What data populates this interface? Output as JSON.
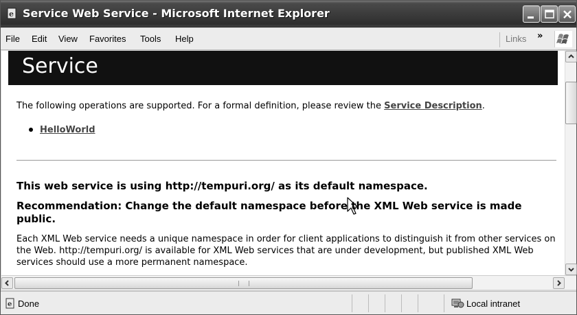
{
  "window": {
    "title": "Service Web Service - Microsoft Internet Explorer"
  },
  "menu": {
    "items": [
      "File",
      "Edit",
      "View",
      "Favorites",
      "Tools",
      "Help"
    ],
    "links_label": "Links",
    "links_chevron": "»"
  },
  "page": {
    "title": "Service",
    "intro_prefix": "The following operations are supported. For a formal definition, please review the ",
    "intro_link": "Service Description",
    "intro_suffix": ".",
    "operations": [
      "HelloWorld"
    ],
    "namespace_heading": "This web service is using http://tempuri.org/ as its default namespace.",
    "recommendation_heading": "Recommendation: Change the default namespace before the XML Web service is made public.",
    "paragraph": "Each XML Web service needs a unique namespace in order for client applications to distinguish it from other services on the Web. http://tempuri.org/ is available for XML Web services that are under development, but published XML Web services should use a more permanent namespace."
  },
  "status": {
    "text": "Done",
    "zone": "Local intranet"
  },
  "icons": {
    "title": "ie-page-icon",
    "status": "page-done-icon",
    "zone": "local-intranet-icon"
  }
}
